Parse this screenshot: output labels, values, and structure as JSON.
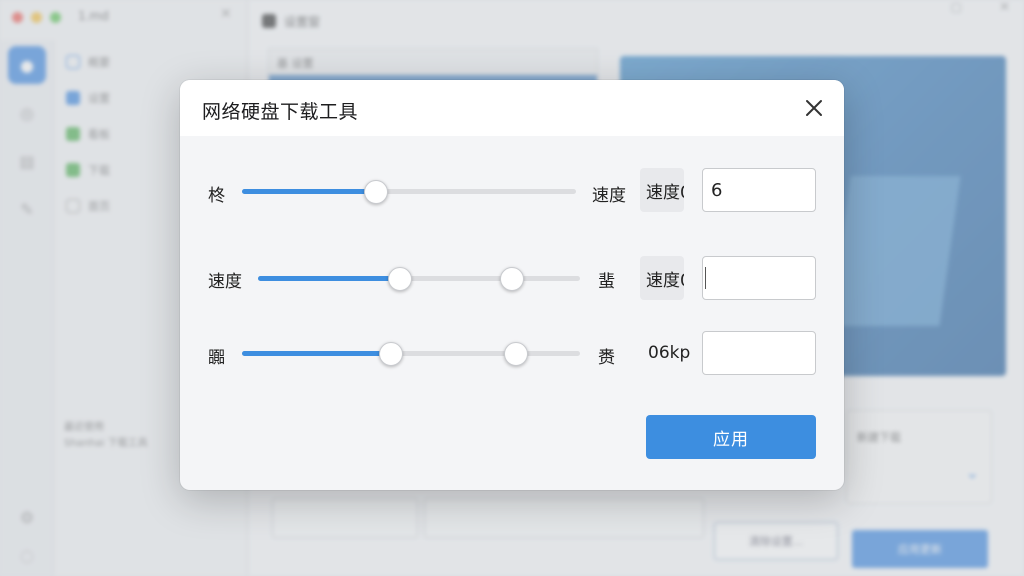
{
  "background": {
    "window_title": "1.md",
    "sidebar_items": [
      "概要",
      "设置",
      "看板",
      "下载",
      "首页"
    ],
    "sidebar_footer": [
      "最近使用",
      "Shanhai 下载工具"
    ],
    "main_title": "设置窗",
    "subpanel_strip": "基 设置",
    "panel_right_label": "新建下载",
    "button_outline": "清除设置...",
    "button_primary": "应用更新"
  },
  "dialog": {
    "title": "网络硬盘下载工具",
    "rows": [
      {
        "label": "柊",
        "right_label": "速度",
        "chip": "速度0",
        "input_value": "6",
        "slider_values": [
          0.4
        ]
      },
      {
        "label": "速度",
        "right_label": "蜚",
        "chip": "速度0",
        "input_value": "",
        "slider_values": [
          0.44,
          0.79
        ]
      },
      {
        "label": "嚻",
        "right_label": "赉",
        "plain_value": "06kp",
        "input_value": "",
        "slider_values": [
          0.44,
          0.81
        ]
      }
    ],
    "apply_label": "应用"
  },
  "colors": {
    "accent": "#3d8ee0",
    "track": "#dcdde0",
    "dialog_bg": "#f4f5f7"
  },
  "icons": {
    "close": "close-icon"
  }
}
